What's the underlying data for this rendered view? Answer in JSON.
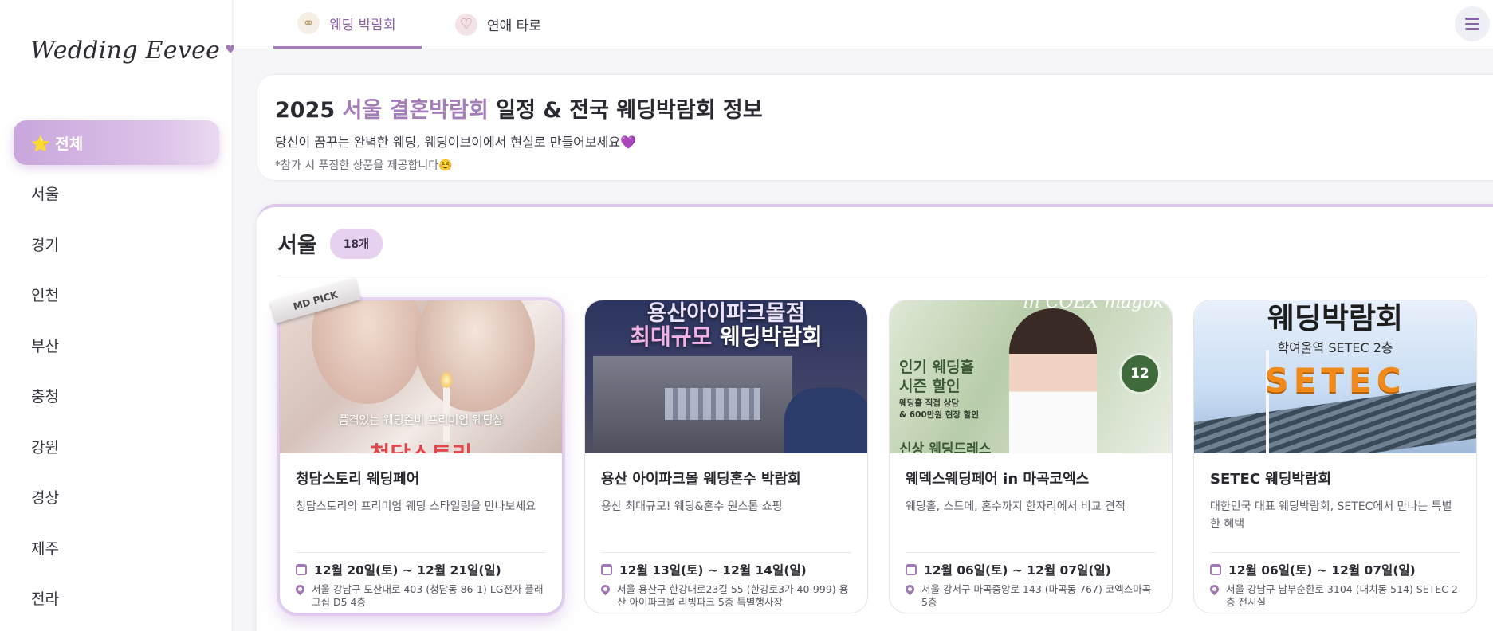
{
  "sidebar": {
    "logo": "Wedding Eevee",
    "logo_heart": "♥",
    "items": [
      {
        "label": "⭐ 전체",
        "active": true
      },
      {
        "label": "서울"
      },
      {
        "label": "경기"
      },
      {
        "label": "인천"
      },
      {
        "label": "부산"
      },
      {
        "label": "충청"
      },
      {
        "label": "강원"
      },
      {
        "label": "경상"
      },
      {
        "label": "제주"
      },
      {
        "label": "전라"
      }
    ]
  },
  "topbar": {
    "tabs": [
      {
        "label": "웨딩 박람회",
        "icon": "rings-icon",
        "active": true
      },
      {
        "label": "연애 타로",
        "icon": "couple-icon"
      }
    ],
    "menu_icon": "hamburger-menu-icon"
  },
  "intro": {
    "title_prefix": "2025 ",
    "title_accent": "서울 결혼박람회",
    "title_suffix": " 일정 & 전국 웨딩박람회 정보",
    "subtitle": "당신이 꿈꾸는 완벽한 웨딩, 웨딩이브이에서 현실로 만들어보세요💜",
    "note": "*참가 시 푸짐한 상품을 제공합니다☺️"
  },
  "section": {
    "title": "서울",
    "count": "18개",
    "cards": [
      {
        "badge": "MD PICK",
        "image_caption": "품격있는 웨딩준비 프리미엄 웨딩샵",
        "image_brand": "청담스토리",
        "title": "청담스토리 웨딩페어",
        "desc": "청담스토리의 프리미엄 웨딩 스타일링을 만나보세요",
        "date": "12월 20일(토) ~ 12월 21일(일)",
        "location": "서울 강남구 도산대로 403 (청담동 86-1) LG전자 플래그십 D5 4층"
      },
      {
        "image_line1": "용산아이파크몰점",
        "image_line2a": "최대규모",
        "image_line2b": " 웨딩박람회",
        "title": "용산 아이파크몰 웨딩혼수 박람회",
        "desc": "용산 최대규모! 웨딩&혼수 원스톱 쇼핑",
        "date": "12월 13일(토) ~ 12월 14일(일)",
        "location": "서울 용산구 한강대로23길 55 (한강로3가 40-999) 용산 아이파크몰 리빙파크 5층 특별행사장"
      },
      {
        "image_brand": "in COEX magok",
        "image_line1": "인기 웨딩홀\n시즌 할인",
        "image_line2": "웨딩홀 직접 상담\n& 600만원 현장 할인",
        "image_line3": "신상 웨딩드레스",
        "image_seal": "12",
        "title": "웨덱스웨딩페어 in 마곡코엑스",
        "desc": "웨딩홀, 스드메, 혼수까지 한자리에서 비교 견적",
        "date": "12월 06일(토) ~ 12월 07일(일)",
        "location": "서울 강서구 마곡중앙로 143 (마곡동 767) 코엑스마곡 5층"
      },
      {
        "image_line1": "웨딩박람회",
        "image_line2": "학여울역 SETEC 2층",
        "image_sign": "SETEC",
        "title": "SETEC 웨딩박람회",
        "desc": "대한민국 대표 웨딩박람회, SETEC에서 만나는 특별한 혜택",
        "date": "12월 06일(토) ~ 12월 07일(일)",
        "location": "서울 강남구 남부순환로 3104 (대치동 514) SETEC 2층 전시실"
      }
    ]
  }
}
